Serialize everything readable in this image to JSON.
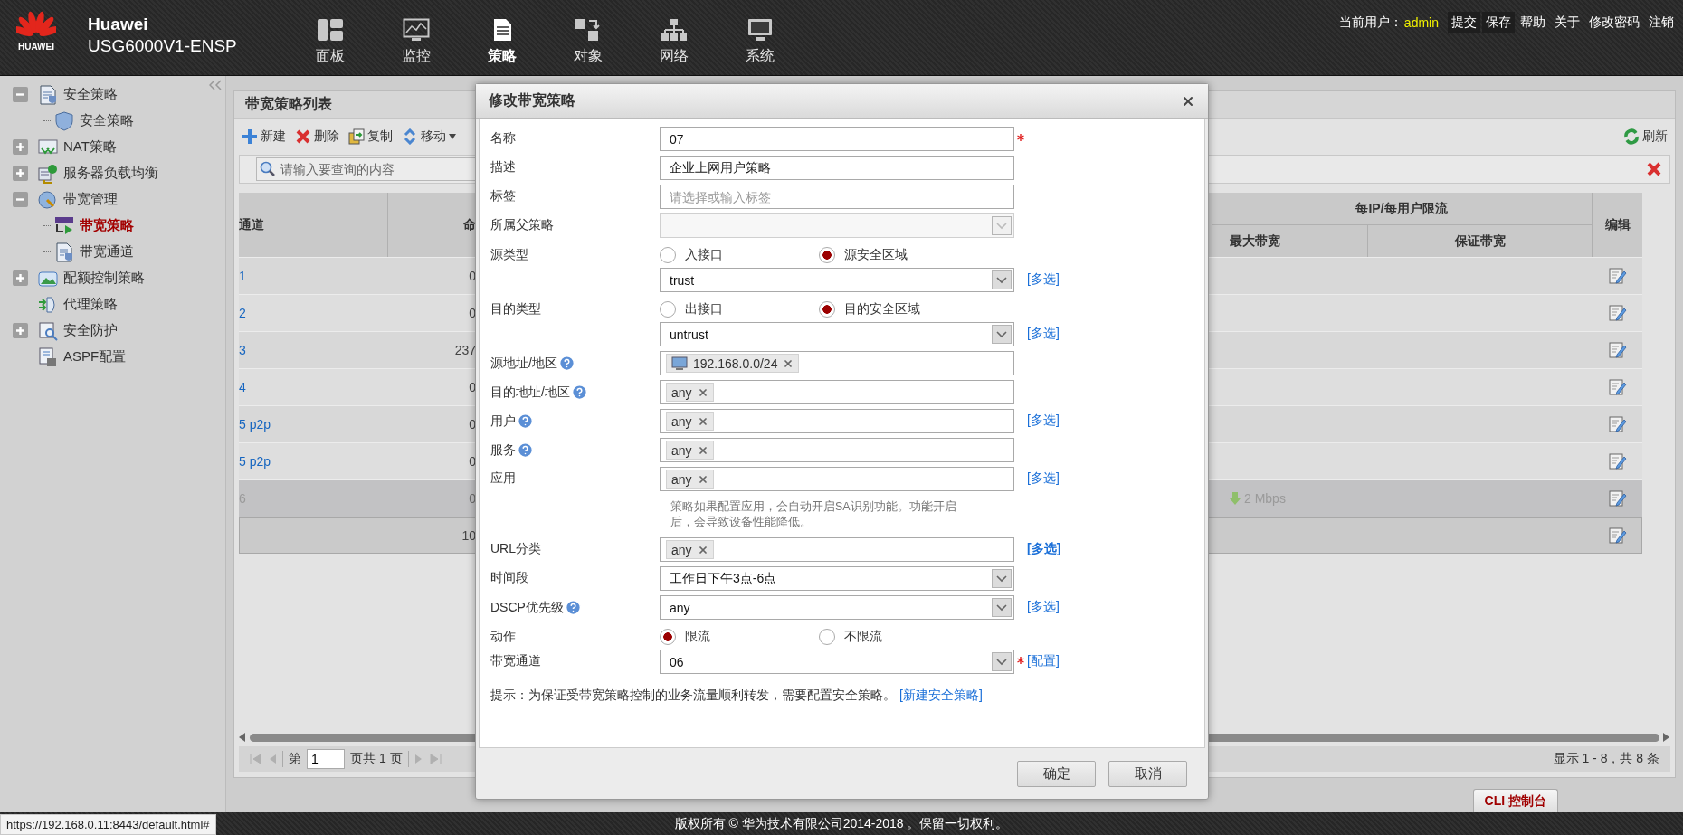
{
  "header": {
    "brand": "HUAWEI",
    "product": "Huawei",
    "model": "USG6000V1-ENSP",
    "nav": [
      {
        "label": "面板",
        "selected": false
      },
      {
        "label": "监控",
        "selected": false
      },
      {
        "label": "策略",
        "selected": true
      },
      {
        "label": "对象",
        "selected": false
      },
      {
        "label": "网络",
        "selected": false
      },
      {
        "label": "系统",
        "selected": false
      }
    ],
    "user_label": "当前用户：",
    "user": "admin",
    "actions": [
      "提交",
      "保存"
    ],
    "links": [
      "帮助",
      "关于",
      "修改密码",
      "注销"
    ]
  },
  "sidebar": {
    "items": [
      {
        "label": "安全策略",
        "expanded": true,
        "selected": false,
        "children": [
          {
            "label": "安全策略",
            "selected": false
          }
        ]
      },
      {
        "label": "NAT策略",
        "expanded": false,
        "selected": false
      },
      {
        "label": "服务器负载均衡",
        "expanded": false,
        "selected": false
      },
      {
        "label": "带宽管理",
        "expanded": true,
        "selected": false,
        "children": [
          {
            "label": "带宽策略",
            "selected": true
          },
          {
            "label": "带宽通道",
            "selected": false
          }
        ]
      },
      {
        "label": "配额控制策略",
        "expanded": false,
        "selected": false
      },
      {
        "label": "代理策略",
        "selected": false
      },
      {
        "label": "安全防护",
        "expanded": false,
        "selected": false
      },
      {
        "label": "ASPF配置",
        "selected": false
      }
    ]
  },
  "panel": {
    "title": "带宽策略列表",
    "toolbar": [
      {
        "label": "新建"
      },
      {
        "label": "删除"
      },
      {
        "label": "复制"
      },
      {
        "label": "移动",
        "menu": true
      }
    ],
    "refresh": "刷新",
    "search": {
      "placeholder": "请输入要查询的内容"
    },
    "table": {
      "columns": [
        "通道",
        "命"
      ],
      "group": {
        "label": "每IP/每用户限流",
        "columns": [
          "最大带宽",
          "保证带宽"
        ]
      },
      "edit_column": "编辑",
      "rows": [
        {
          "channel": "1",
          "hits": "0",
          "selected": false,
          "disabled": false
        },
        {
          "channel": "2",
          "hits": "0",
          "selected": false,
          "disabled": false
        },
        {
          "channel": "3",
          "hits": "237",
          "selected": false,
          "disabled": false
        },
        {
          "channel": "4",
          "hits": "0",
          "selected": false,
          "disabled": false
        },
        {
          "channel": "5 p2p",
          "hits": "0",
          "selected": false,
          "disabled": false
        },
        {
          "channel": "5 p2p",
          "hits": "0",
          "selected": false,
          "disabled": false
        },
        {
          "channel": "6",
          "hits": "0",
          "max_bandwidth": "2 Mbps",
          "selected": false,
          "disabled": true
        },
        {
          "hits": "10",
          "selected": true,
          "disabled": false
        }
      ]
    },
    "pager": {
      "page_prefix": "第",
      "page": "1",
      "page_suffix": "页共 1 页",
      "summary": "显示 1 - 8，共 8 条"
    }
  },
  "dialog": {
    "title": "修改带宽策略",
    "fields": [
      {
        "kind": "text",
        "label": "名称",
        "value": "07",
        "required": true
      },
      {
        "kind": "text",
        "label": "描述",
        "value": "企业上网用户策略"
      },
      {
        "kind": "text",
        "label": "标签",
        "placeholder": "请选择或输入标签"
      },
      {
        "kind": "select",
        "label": "所属父策略",
        "disabled": true
      },
      {
        "kind": "radio",
        "label": "源类型",
        "options": [
          {
            "label": "入接口",
            "selected": false
          },
          {
            "label": "源安全区域",
            "selected": true
          }
        ]
      },
      {
        "kind": "select",
        "value": "trust",
        "link": {
          "text": "[多选]",
          "bold": false
        }
      },
      {
        "kind": "radio",
        "label": "目的类型",
        "options": [
          {
            "label": "出接口",
            "selected": false
          },
          {
            "label": "目的安全区域",
            "selected": true
          }
        ]
      },
      {
        "kind": "select",
        "value": "untrust",
        "link": {
          "text": "[多选]",
          "bold": false
        }
      },
      {
        "kind": "tags",
        "label": "源地址/地区",
        "help": true,
        "tags": [
          {
            "kind": "address",
            "text": "192.168.0.0/24"
          }
        ]
      },
      {
        "kind": "tags",
        "label": "目的地址/地区",
        "help": true,
        "tags": [
          {
            "kind": "plain",
            "text": "any"
          }
        ]
      },
      {
        "kind": "tags",
        "label": "用户",
        "help": true,
        "tags": [
          {
            "kind": "plain",
            "text": "any"
          }
        ],
        "link": {
          "text": "[多选]",
          "bold": false
        }
      },
      {
        "kind": "tags",
        "label": "服务",
        "help": true,
        "tags": [
          {
            "kind": "plain",
            "text": "any"
          }
        ]
      },
      {
        "kind": "tags",
        "label": "应用",
        "tags": [
          {
            "kind": "plain",
            "text": "any"
          }
        ],
        "link": {
          "text": "[多选]",
          "bold": false
        }
      },
      {
        "kind": "note",
        "text": "策略如果配置应用，会自动开启SA识别功能。功能开启后，会导致设备性能降低。"
      },
      {
        "kind": "tags",
        "label": "URL分类",
        "tags": [
          {
            "kind": "plain",
            "text": "any"
          }
        ],
        "link": {
          "text": "[多选]",
          "bold": true
        }
      },
      {
        "kind": "select",
        "label": "时间段",
        "value": "工作日下午3点-6点"
      },
      {
        "kind": "select",
        "label": "DSCP优先级",
        "help": true,
        "value": "any",
        "link": {
          "text": "[多选]",
          "bold": false
        }
      },
      {
        "kind": "radio",
        "label": "动作",
        "options": [
          {
            "label": "限流",
            "selected": true
          },
          {
            "label": "不限流",
            "selected": false
          }
        ]
      },
      {
        "kind": "select",
        "label": "带宽通道",
        "value": "06",
        "required": true,
        "link": {
          "text": "[配置]",
          "bold": false
        }
      }
    ],
    "tip": {
      "text": "提示：为保证受带宽策略控制的业务流量顺利转发，需要配置安全策略。",
      "link": "[新建安全策略]"
    },
    "buttons": [
      "确定",
      "取消"
    ]
  },
  "cli_tab": "CLI 控制台",
  "status_url": "https://192.168.0.11:8443/default.html#",
  "footer": "版权所有 © 华为技术有限公司2014-2018 。保留一切权利。"
}
